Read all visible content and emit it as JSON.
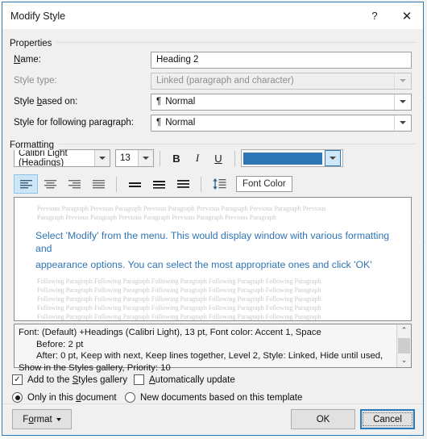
{
  "window": {
    "title": "Modify Style",
    "help_label": "?",
    "close_label": "✕"
  },
  "properties": {
    "group_label": "Properties",
    "name": {
      "label_pre": "N",
      "label_key": "a",
      "label_post": "me:",
      "label": "Name:",
      "value": "Heading 2"
    },
    "style_type": {
      "label": "Style type:",
      "value": "Linked (paragraph and character)"
    },
    "style_based_on": {
      "label": "Style based on:",
      "value": "Normal",
      "glyph": "¶"
    },
    "style_following": {
      "label": "Style for following paragraph:",
      "value": "Normal",
      "glyph": "¶"
    }
  },
  "formatting": {
    "group_label": "Formatting",
    "font_family": "Calibri Light (Headings)",
    "font_size": "13",
    "bold_label": "B",
    "italic_label": "I",
    "underline_label": "U",
    "font_color": "#2e75b6",
    "tooltip": "Font Color",
    "align_left_icon": "align-left",
    "align_center_icon": "align-center",
    "align_right_icon": "align-right",
    "align_justify_icon": "align-justify",
    "spacing_single_icon": "line-spacing-single",
    "spacing_15_icon": "line-spacing-1.5",
    "spacing_double_icon": "line-spacing-double",
    "spacing_icon": "paragraph-spacing",
    "indent_icon": "increase-indent"
  },
  "preview": {
    "previous_line1": "Previous Paragraph Previous Paragraph Previous Paragraph Previous Paragraph Previous Paragraph Previous",
    "previous_line2": "Paragraph Previous Paragraph Previous Paragraph Previous Paragraph Previous Paragraph",
    "sample_line1": "Select 'Modify' from the menu. This would display window with various formatting and",
    "sample_line2": "appearance options. You can select the most appropriate ones and click 'OK'",
    "following_line": "Following Paragraph Following Paragraph Following Paragraph Following Paragraph Following Paragraph",
    "following_count": 6
  },
  "description": {
    "line1": "Font: (Default) +Headings (Calibri Light), 13 pt, Font color: Accent 1, Space",
    "line2": "Before:  2 pt",
    "line3": "After:  0 pt, Keep with next, Keep lines together, Level 2, Style: Linked, Hide until used,",
    "line4": "Show in the Styles gallery, Priority: 10",
    "scroll_up": "⌃",
    "scroll_down": "⌄"
  },
  "options": {
    "add_to_gallery": {
      "label": "Add to the Styles gallery",
      "checked": true,
      "check_glyph": "✓"
    },
    "automatically_update": {
      "label": "Automatically update",
      "checked": false
    },
    "only_this_document": {
      "label": "Only in this document",
      "selected": true
    },
    "new_documents": {
      "label": "New documents based on this template",
      "selected": false
    }
  },
  "buttons": {
    "format": "Format",
    "ok": "OK",
    "cancel": "Cancel"
  },
  "backdrop": {
    "snippet_f": "F",
    "snippet_a": "¶"
  }
}
